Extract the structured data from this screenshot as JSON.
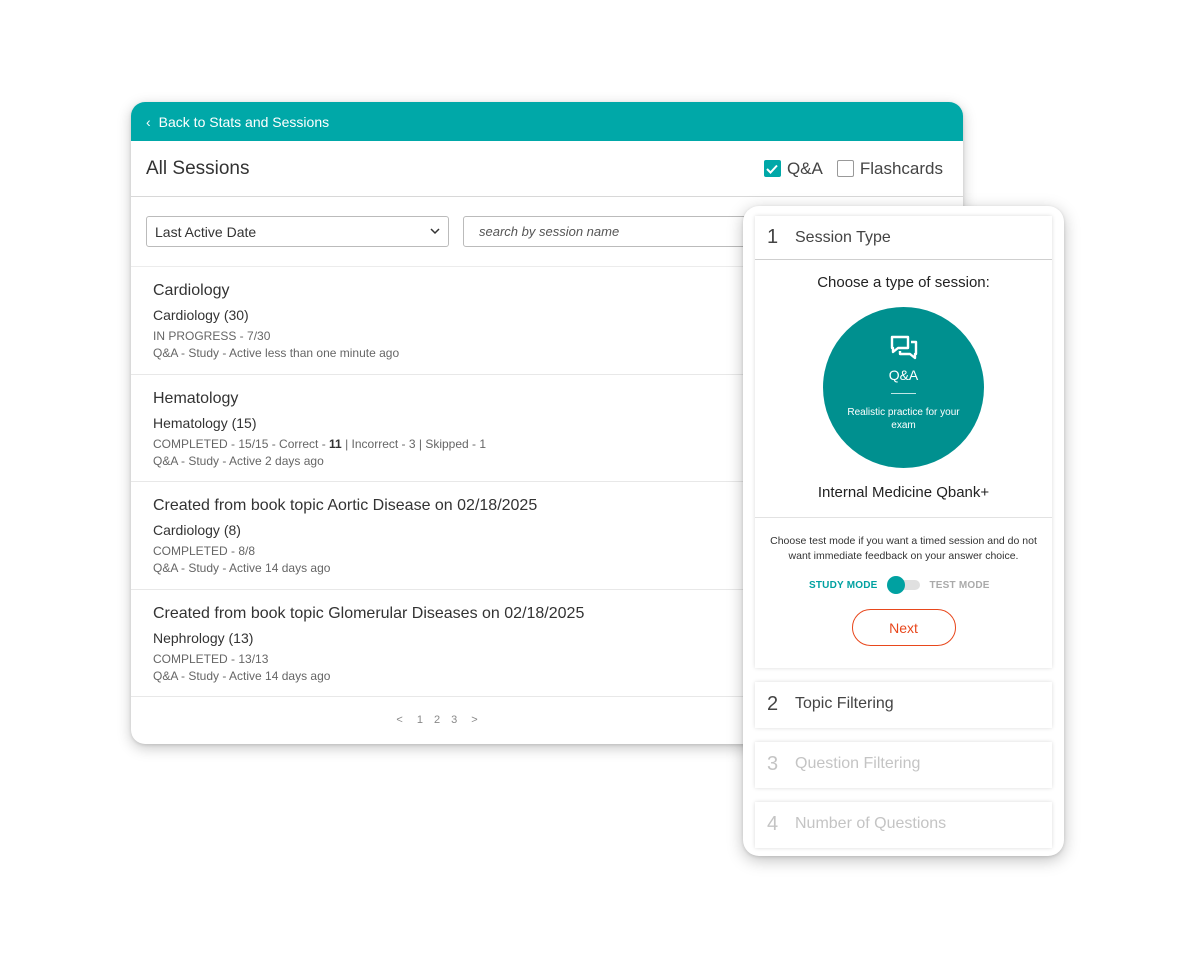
{
  "sessions_panel": {
    "back_label": "Back to Stats and Sessions",
    "title": "All Sessions",
    "filters": [
      {
        "label": "Q&A",
        "checked": true
      },
      {
        "label": "Flashcards",
        "checked": false
      }
    ],
    "sort_value": "Last Active Date",
    "search_placeholder": "search by session name",
    "sessions": [
      {
        "title": "Cardiology",
        "topic": "Cardiology (30)",
        "status": "IN PROGRESS - 7/30",
        "meta": "Q&A - Study - Active less than one minute ago"
      },
      {
        "title": "Hematology",
        "topic": "Hematology (15)",
        "status_prefix": "COMPLETED - 15/15 - Correct - ",
        "correct": "11",
        "status_mid": " | Incorrect - 3 | Skipped - 1",
        "meta": "Q&A - Study - Active 2 days ago"
      },
      {
        "title": "Created from book topic Aortic Disease on 02/18/2025",
        "topic": "Cardiology (8)",
        "status": "COMPLETED - 8/8",
        "meta": "Q&A - Study - Active 14 days ago"
      },
      {
        "title": "Created from book topic Glomerular Diseases on 02/18/2025",
        "topic": "Nephrology (13)",
        "status": "COMPLETED - 13/13",
        "meta": "Q&A - Study - Active 14 days ago"
      }
    ],
    "pagination": {
      "prev": "<",
      "pages": [
        "1",
        "2",
        "3"
      ],
      "next": ">"
    }
  },
  "wizard": {
    "steps": [
      {
        "num": "1",
        "label": "Session Type"
      },
      {
        "num": "2",
        "label": "Topic Filtering"
      },
      {
        "num": "3",
        "label": "Question Filtering"
      },
      {
        "num": "4",
        "label": "Number of Questions"
      }
    ],
    "choose_label": "Choose a type of session:",
    "session_type": {
      "title": "Q&A",
      "description": "Realistic practice for your exam"
    },
    "bank_name": "Internal Medicine Qbank+",
    "mode_help": "Choose test mode if you want a timed session and do not want immediate feedback on your answer choice.",
    "study_mode_label": "STUDY MODE",
    "test_mode_label": "TEST MODE",
    "mode_selected": "STUDY MODE",
    "next_label": "Next"
  },
  "colors": {
    "teal": "#00a8a8",
    "teal_dark": "#00908f",
    "orange": "#e8471c"
  }
}
